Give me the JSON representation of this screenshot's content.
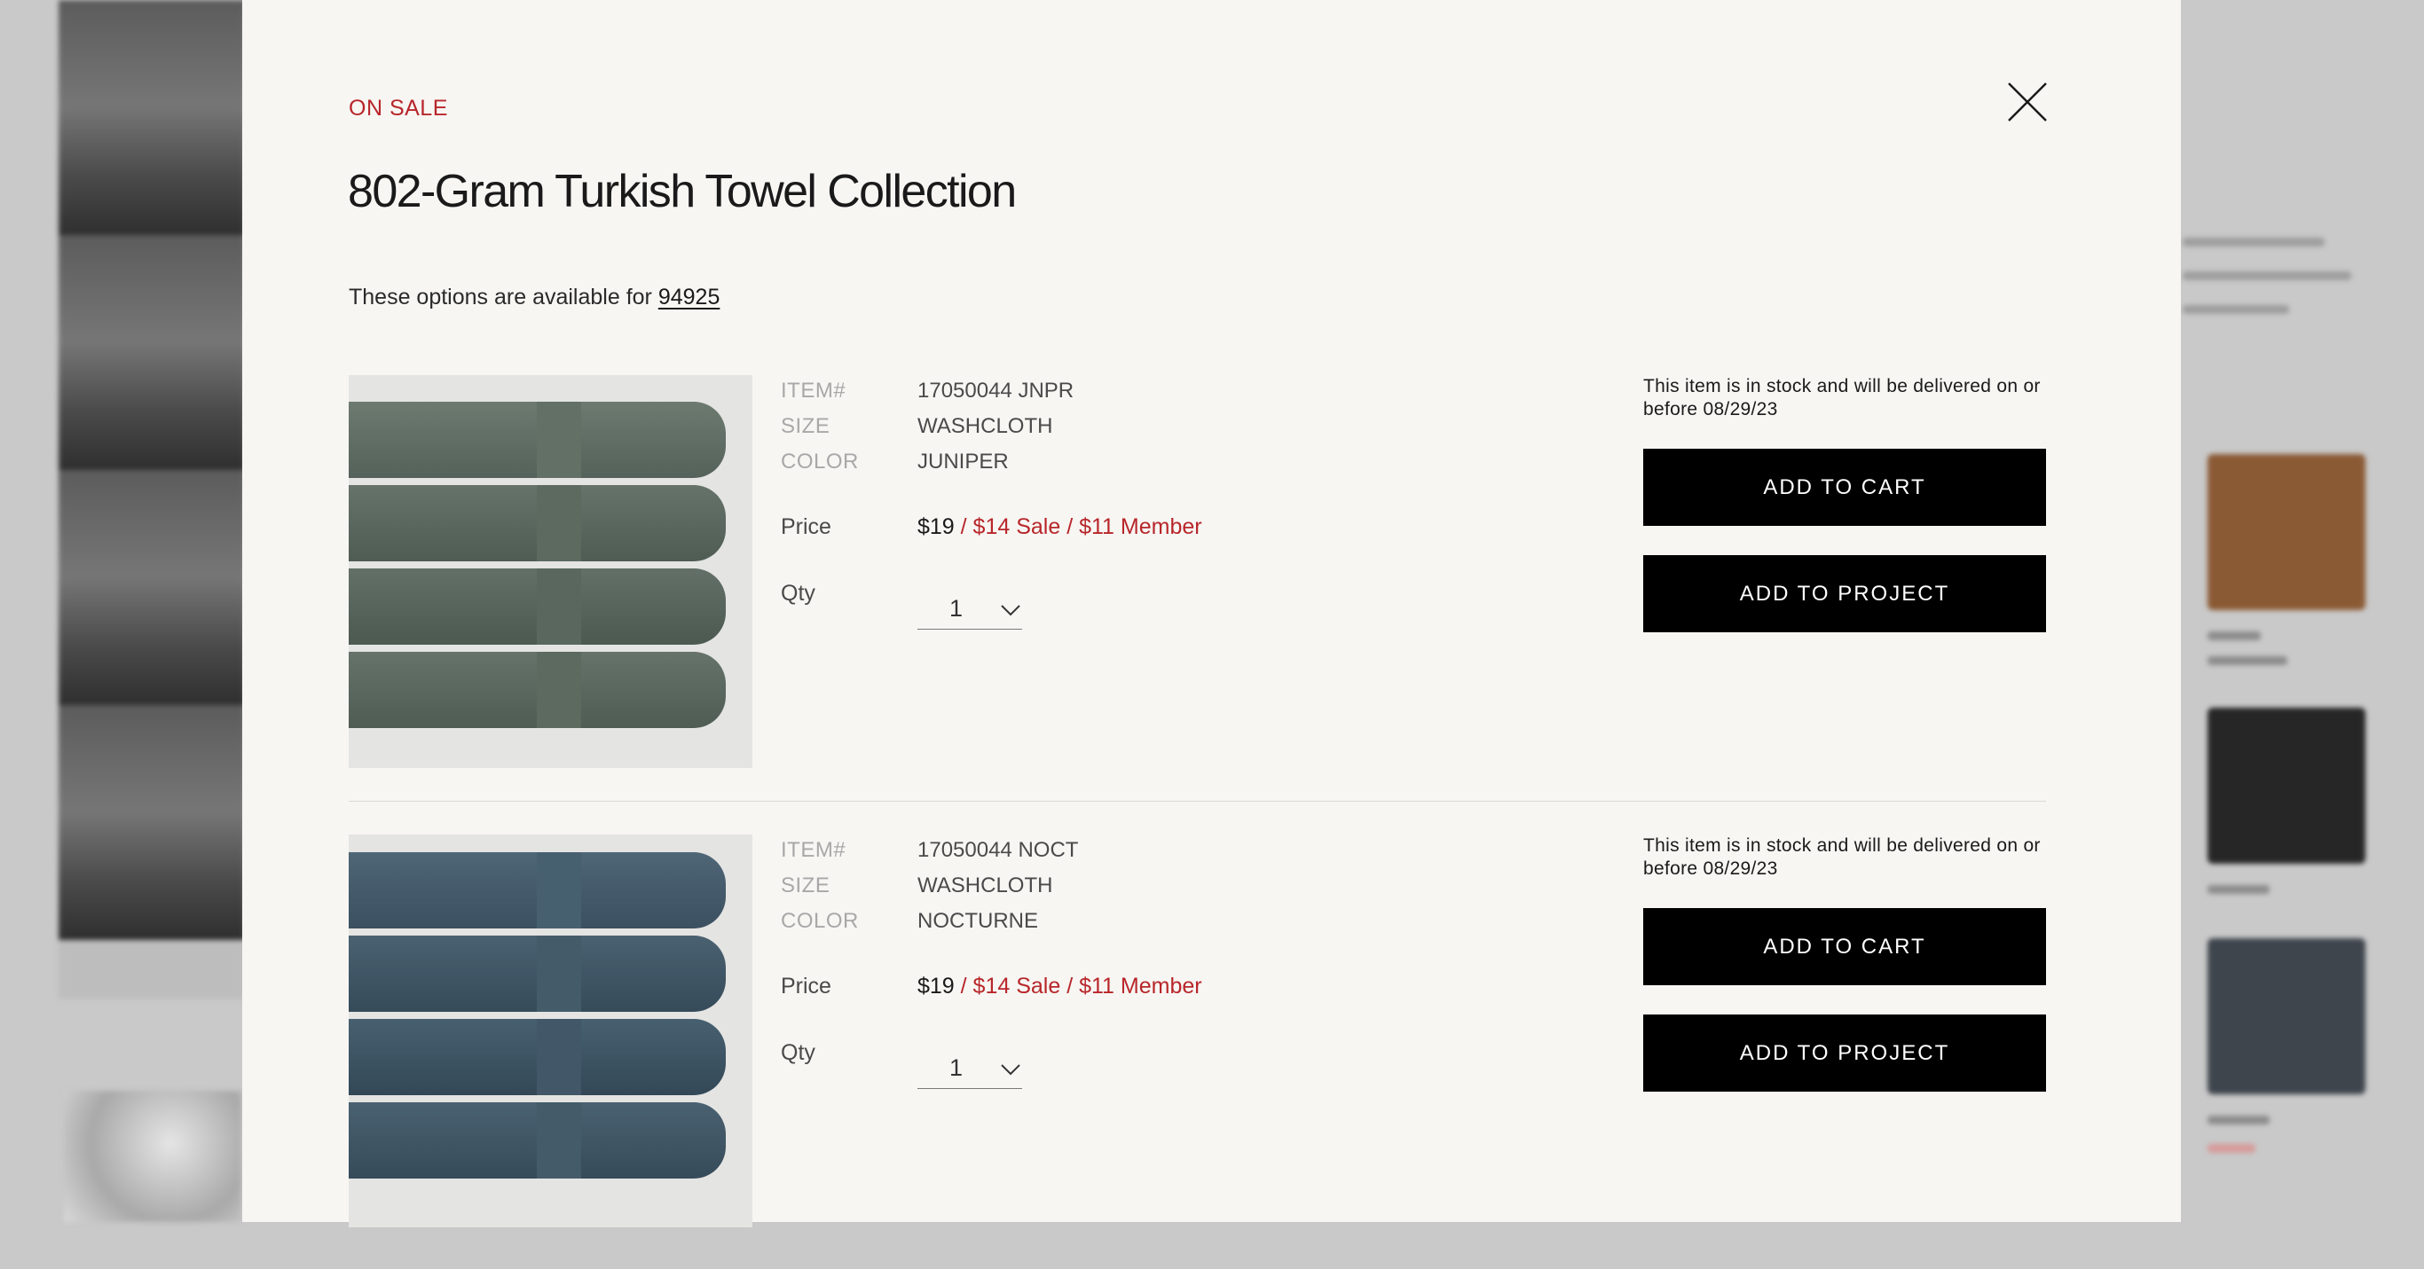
{
  "modal": {
    "badge": "ON SALE",
    "title": "802-Gram Turkish Towel Collection",
    "availability_prefix": "These options are available for ",
    "zip_code": "94925",
    "icons": {
      "close": "close-icon",
      "qty_chevron": "chevron-down-icon"
    }
  },
  "labels": {
    "item": "ITEM#",
    "size": "SIZE",
    "color": "COLOR",
    "price": "Price",
    "qty": "Qty"
  },
  "products": [
    {
      "item_number": "17050044 JNPR",
      "size": "WASHCLOTH",
      "color": "JUNIPER",
      "price_regular": "$19",
      "price_sale": " / $14 Sale / $11 Member",
      "qty": "1",
      "stock_message": "This item is in stock and will be delivered on or before 08/29/23",
      "add_to_cart": "ADD TO CART",
      "add_to_project": "ADD TO PROJECT",
      "swatch_color": "#5f6d64"
    },
    {
      "item_number": "17050044 NOCT",
      "size": "WASHCLOTH",
      "color": "NOCTURNE",
      "price_regular": "$19",
      "price_sale": " / $14 Sale / $11 Member",
      "qty": "1",
      "stock_message": "This item is in stock and will be delivered on or before 08/29/23",
      "add_to_cart": "ADD TO CART",
      "add_to_project": "ADD TO PROJECT",
      "swatch_color": "#3e5565"
    }
  ],
  "colors": {
    "sale_red": "#b8262a",
    "button_bg": "#000000",
    "modal_bg": "#f7f6f3"
  }
}
